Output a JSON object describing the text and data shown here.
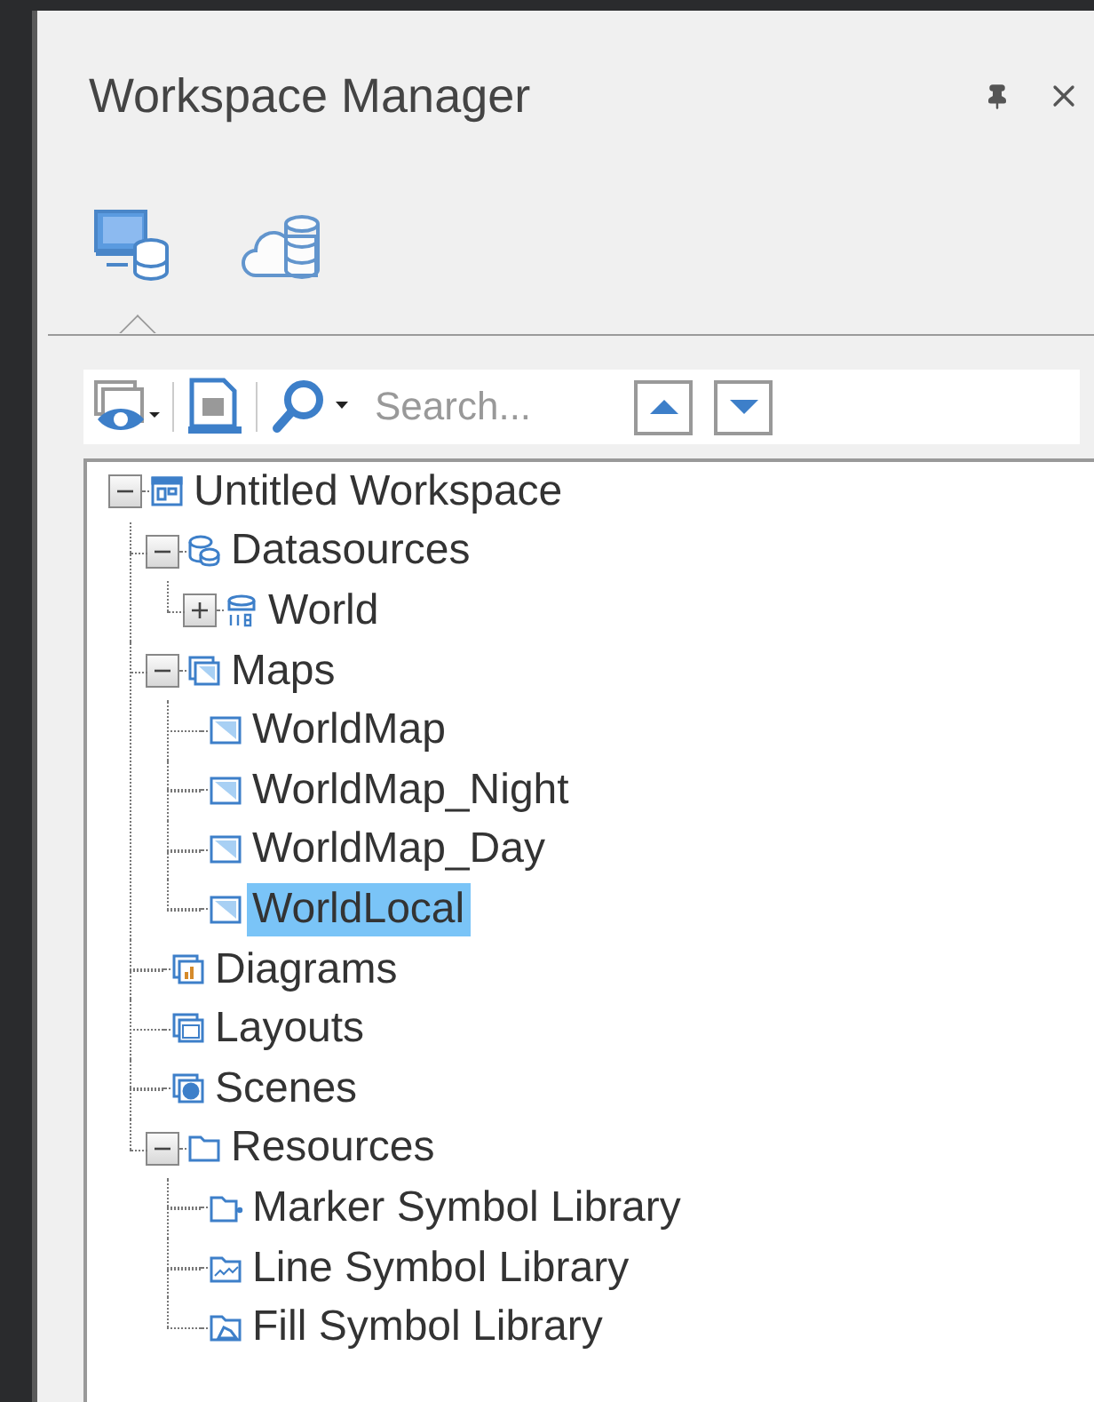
{
  "panel": {
    "title": "Workspace Manager"
  },
  "tabs": [
    {
      "kind": "local",
      "selected": true
    },
    {
      "kind": "cloud",
      "selected": false
    }
  ],
  "toolbar": {
    "search": {
      "placeholder": "Search..."
    }
  },
  "tree": [
    {
      "label": "Untitled Workspace",
      "kind": "workspace",
      "expanded": true,
      "selected": false,
      "children": [
        {
          "label": "Datasources",
          "kind": "datasources",
          "expanded": true,
          "selected": false,
          "children": [
            {
              "label": "World",
              "kind": "database",
              "expanded": false,
              "selected": false
            }
          ]
        },
        {
          "label": "Maps",
          "kind": "maps",
          "expanded": true,
          "selected": false,
          "children": [
            {
              "label": "WorldMap",
              "kind": "map",
              "selected": false
            },
            {
              "label": "WorldMap_Night",
              "kind": "map",
              "selected": false
            },
            {
              "label": "WorldMap_Day",
              "kind": "map",
              "selected": false
            },
            {
              "label": "WorldLocal",
              "kind": "map",
              "selected": true
            }
          ]
        },
        {
          "label": "Diagrams",
          "kind": "diagrams",
          "selected": false
        },
        {
          "label": "Layouts",
          "kind": "layouts",
          "selected": false
        },
        {
          "label": "Scenes",
          "kind": "scenes",
          "selected": false
        },
        {
          "label": "Resources",
          "kind": "folder",
          "expanded": true,
          "selected": false,
          "children": [
            {
              "label": "Marker Symbol Library",
              "kind": "marker-library",
              "selected": false
            },
            {
              "label": "Line Symbol Library",
              "kind": "line-library",
              "selected": false
            },
            {
              "label": "Fill Symbol Library",
              "kind": "fill-library",
              "selected": false
            }
          ]
        }
      ]
    }
  ]
}
